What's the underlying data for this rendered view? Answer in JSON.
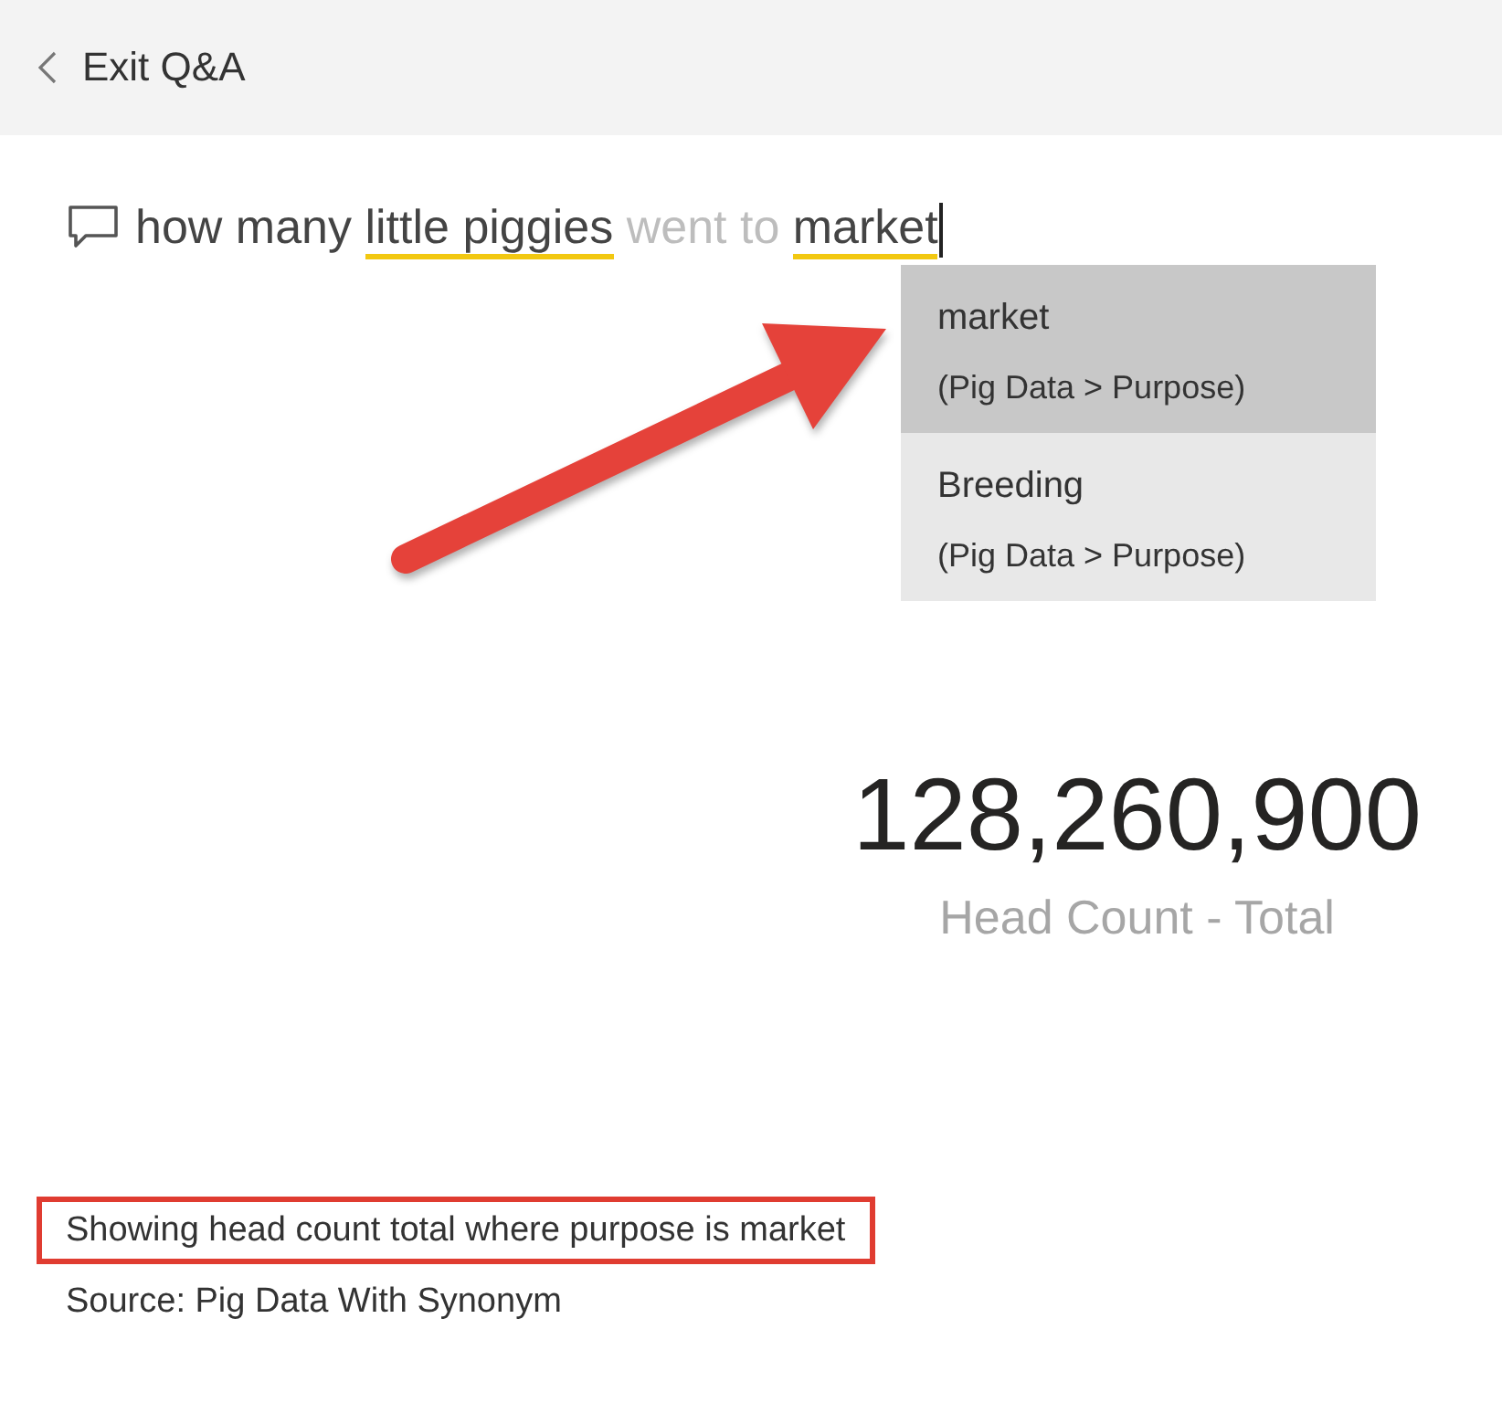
{
  "header": {
    "back_label": "Exit Q&A"
  },
  "question": {
    "focused": true,
    "segments": [
      {
        "text": "how many",
        "kind": "plain"
      },
      {
        "text": "little piggies",
        "kind": "matched"
      },
      {
        "text": "went to",
        "kind": "unmatched"
      },
      {
        "text": "market",
        "kind": "matched"
      }
    ]
  },
  "suggestions": [
    {
      "term": "market",
      "source": "(Pig Data > Purpose)",
      "selected": true
    },
    {
      "term": "Breeding",
      "source": "(Pig Data > Purpose)",
      "selected": false
    }
  ],
  "card": {
    "value": "128,260,900",
    "label": "Head Count - Total"
  },
  "footer": {
    "restatement": "Showing head count total where purpose is market",
    "highlighted": true,
    "source": "Source: Pig Data With Synonym"
  }
}
